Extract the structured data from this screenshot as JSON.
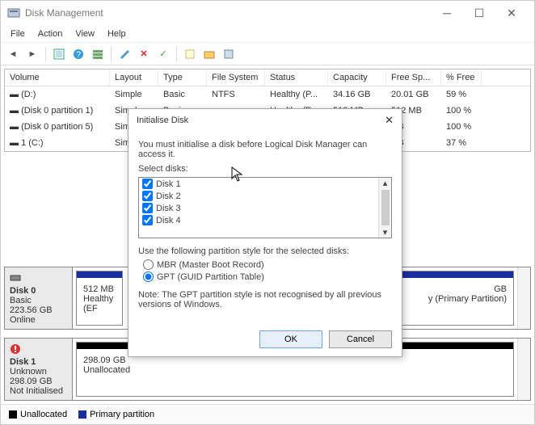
{
  "window": {
    "title": "Disk Management"
  },
  "menu": {
    "file": "File",
    "action": "Action",
    "view": "View",
    "help": "Help"
  },
  "columns": {
    "volume": "Volume",
    "layout": "Layout",
    "type": "Type",
    "fs": "File System",
    "status": "Status",
    "cap": "Capacity",
    "free": "Free Sp...",
    "pct": "% Free"
  },
  "volumes": [
    {
      "name": "(D:)",
      "layout": "Simple",
      "type": "Basic",
      "fs": "NTFS",
      "status": "Healthy (P...",
      "cap": "34.16 GB",
      "free": "20.01 GB",
      "pct": "59 %"
    },
    {
      "name": "(Disk 0 partition 1)",
      "layout": "Simple",
      "type": "Basic",
      "fs": "",
      "status": "Healthy (E...",
      "cap": "512 MB",
      "free": "512 MB",
      "pct": "100 %"
    },
    {
      "name": "(Disk 0 partition 5)",
      "layout": "Simple",
      "type": "Basic",
      "fs": "",
      "status": "",
      "cap": "",
      "free": "GB",
      "pct": "100 %"
    },
    {
      "name": "1 (C:)",
      "layout": "Simple",
      "type": "",
      "fs": "",
      "status": "",
      "cap": "",
      "free": "GB",
      "pct": "37 %"
    }
  ],
  "disk0": {
    "name": "Disk 0",
    "kind": "Basic",
    "size": "223.56 GB",
    "state": "Online",
    "p1_size": "512 MB",
    "p1_status": "Healthy (EF",
    "p2_size": "GB",
    "p2_status": "y (Primary Partition)"
  },
  "disk1": {
    "name": "Disk 1",
    "kind": "Unknown",
    "size": "298.09 GB",
    "state": "Not Initialised",
    "p1_size": "298.09 GB",
    "p1_status": "Unallocated"
  },
  "legend": {
    "unalloc": "Unallocated",
    "primary": "Primary partition"
  },
  "dialog": {
    "title": "Initialise Disk",
    "msg": "You must initialise a disk before Logical Disk Manager can access it.",
    "select": "Select disks:",
    "d1": "Disk 1",
    "d2": "Disk 2",
    "d3": "Disk 3",
    "d4": "Disk 4",
    "ps_label": "Use the following partition style for the selected disks:",
    "mbr": "MBR (Master Boot Record)",
    "gpt": "GPT (GUID Partition Table)",
    "note": "Note: The GPT partition style is not recognised by all previous versions of Windows.",
    "ok": "OK",
    "cancel": "Cancel"
  }
}
